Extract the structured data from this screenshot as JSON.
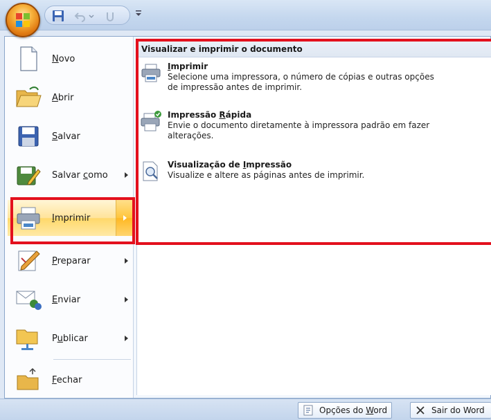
{
  "menu": {
    "items": [
      {
        "label": "Novo",
        "accel": "N",
        "rest": "ovo",
        "icon": "new-document-icon"
      },
      {
        "label": "Abrir",
        "accel": "A",
        "rest": "brir",
        "icon": "open-folder-icon"
      },
      {
        "label": "Salvar",
        "accel": "S",
        "rest": "alvar",
        "icon": "save-icon"
      },
      {
        "label": "Salvar como",
        "pre": "Salvar ",
        "accel": "c",
        "rest": "omo",
        "icon": "save-as-icon"
      },
      {
        "label": "Imprimir",
        "accel": "I",
        "rest": "mprimir",
        "icon": "printer-icon"
      },
      {
        "label": "Preparar",
        "accel": "P",
        "rest": "reparar",
        "icon": "prepare-icon"
      },
      {
        "label": "Enviar",
        "accel": "E",
        "rest": "nviar",
        "icon": "send-icon"
      },
      {
        "label": "Publicar",
        "pre": "P",
        "accel": "u",
        "rest": "blicar",
        "icon": "publish-icon"
      },
      {
        "label": "Fechar",
        "accel": "F",
        "rest": "echar",
        "icon": "close-folder-icon"
      }
    ]
  },
  "panel": {
    "title": "Visualizar e imprimir o documento",
    "options": [
      {
        "title": "Imprimir",
        "title_pre": "",
        "title_accel": "I",
        "title_rest": "mprimir",
        "desc": "Selecione uma impressora, o número de cópias e outras opções de impressão antes de imprimir.",
        "desc_l1": "Selecione uma impressora, o número de cópias e outras opções",
        "desc_l2": "de impressão antes de imprimir.",
        "icon": "printer-icon"
      },
      {
        "title": "Impressão Rápida",
        "title_pre": "Impressão ",
        "title_accel": "R",
        "title_rest": "ápida",
        "desc": "Envie o documento diretamente à impressora padrão em fazer alterações.",
        "desc_l1": "Envie o documento diretamente à impressora padrão em fazer",
        "desc_l2": "alterações.",
        "icon": "quick-print-icon"
      },
      {
        "title": "Visualização de Impressão",
        "title_pre": "Visualização de ",
        "title_accel": "I",
        "title_rest": "mpressão",
        "desc": "Visualize e altere as páginas antes de imprimir.",
        "desc_l1": "Visualize e altere as páginas antes de imprimir.",
        "desc_l2": "",
        "icon": "print-preview-icon"
      }
    ]
  },
  "bottom": {
    "options_label": "Opções do Word",
    "options_pre": "Opções do ",
    "options_accel": "W",
    "options_rest": "ord",
    "exit_label": "Sair do Word",
    "exit_text": "Sair do Word"
  },
  "colors": {
    "highlight": "#e3101d",
    "hover": "#ffd86a",
    "frame": "#8aa5c9"
  }
}
